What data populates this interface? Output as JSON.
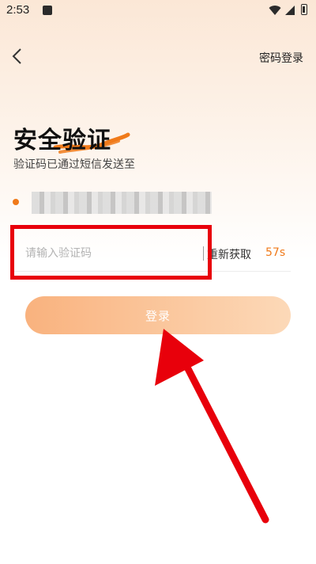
{
  "status_bar": {
    "time": "2:53",
    "notification_icon": "a-icon",
    "wifi_icon": "wifi-icon",
    "signal_icon": "signal-icon",
    "battery_icon": "battery-icon"
  },
  "nav": {
    "back_icon": "chevron-left-icon",
    "password_login": "密码登录"
  },
  "header": {
    "title": "安全验证",
    "subtitle": "验证码已通过短信发送至"
  },
  "phone": {
    "masked": ""
  },
  "code_input": {
    "placeholder": "请输入验证码",
    "value": ""
  },
  "resend": {
    "label": "重新获取",
    "countdown": "57s"
  },
  "login_button": {
    "label": "登录"
  },
  "colors": {
    "accent": "#f07a1a",
    "highlight": "#e8000b",
    "button_start": "#f9b27e",
    "button_end": "#fcd9b8"
  }
}
